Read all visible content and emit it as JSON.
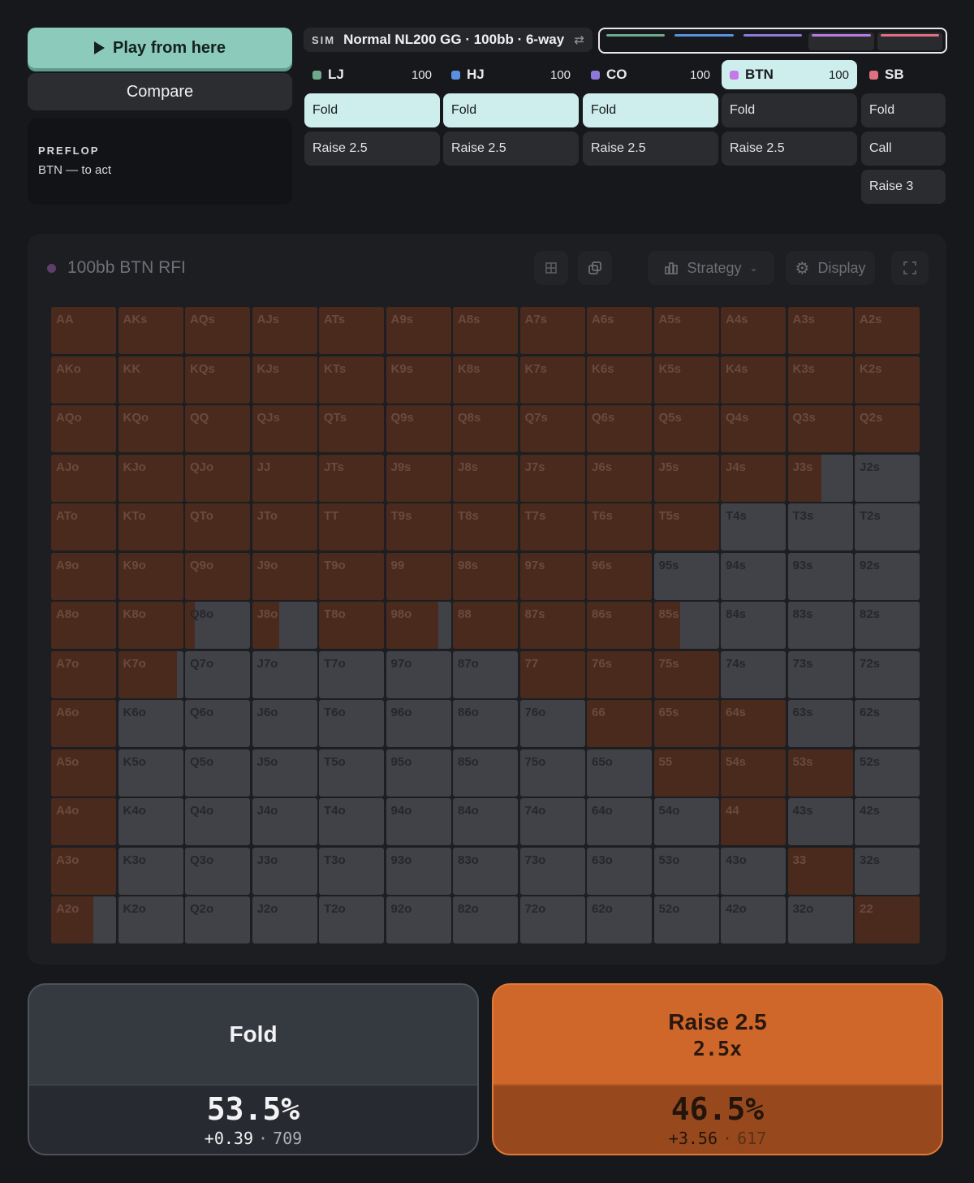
{
  "controls": {
    "play_label": "Play from here",
    "compare_label": "Compare",
    "street": "PREFLOP",
    "to_act": "BTN — to act"
  },
  "sim": {
    "tag": "SIM",
    "title": "Normal NL200 GG · 100bb · 6-way"
  },
  "history_colors": [
    "#6fa98c",
    "#5b8fe0",
    "#8f78d8",
    "#b57be0",
    "#e0707e"
  ],
  "positions": [
    {
      "name": "LJ",
      "stack": "100",
      "color": "#6fa98c",
      "active": false,
      "actions": [
        {
          "label": "Fold",
          "selected": true
        },
        {
          "label": "Raise 2.5",
          "selected": false
        }
      ]
    },
    {
      "name": "HJ",
      "stack": "100",
      "color": "#5b8fe0",
      "active": false,
      "actions": [
        {
          "label": "Fold",
          "selected": true
        },
        {
          "label": "Raise 2.5",
          "selected": false
        }
      ]
    },
    {
      "name": "CO",
      "stack": "100",
      "color": "#8f78d8",
      "active": false,
      "actions": [
        {
          "label": "Fold",
          "selected": true
        },
        {
          "label": "Raise 2.5",
          "selected": false
        }
      ]
    },
    {
      "name": "BTN",
      "stack": "100",
      "color": "#c47ae6",
      "active": true,
      "actions": [
        {
          "label": "Fold",
          "selected": false
        },
        {
          "label": "Raise 2.5",
          "selected": false
        }
      ]
    },
    {
      "name": "SB",
      "stack": "",
      "color": "#e0707e",
      "active": false,
      "actions": [
        {
          "label": "Fold",
          "selected": false
        },
        {
          "label": "Call",
          "selected": false
        },
        {
          "label": "Raise 3",
          "selected": false
        }
      ]
    }
  ],
  "panel": {
    "title": "100bb BTN RFI",
    "strategy_label": "Strategy",
    "display_label": "Display"
  },
  "hands": [
    [
      "AA",
      "AKs",
      "AQs",
      "AJs",
      "ATs",
      "A9s",
      "A8s",
      "A7s",
      "A6s",
      "A5s",
      "A4s",
      "A3s",
      "A2s"
    ],
    [
      "AKo",
      "KK",
      "KQs",
      "KJs",
      "KTs",
      "K9s",
      "K8s",
      "K7s",
      "K6s",
      "K5s",
      "K4s",
      "K3s",
      "K2s"
    ],
    [
      "AQo",
      "KQo",
      "QQ",
      "QJs",
      "QTs",
      "Q9s",
      "Q8s",
      "Q7s",
      "Q6s",
      "Q5s",
      "Q4s",
      "Q3s",
      "Q2s"
    ],
    [
      "AJo",
      "KJo",
      "QJo",
      "JJ",
      "JTs",
      "J9s",
      "J8s",
      "J7s",
      "J6s",
      "J5s",
      "J4s",
      "J3s",
      "J2s"
    ],
    [
      "ATo",
      "KTo",
      "QTo",
      "JTo",
      "TT",
      "T9s",
      "T8s",
      "T7s",
      "T6s",
      "T5s",
      "T4s",
      "T3s",
      "T2s"
    ],
    [
      "A9o",
      "K9o",
      "Q9o",
      "J9o",
      "T9o",
      "99",
      "98s",
      "97s",
      "96s",
      "95s",
      "94s",
      "93s",
      "92s"
    ],
    [
      "A8o",
      "K8o",
      "Q8o",
      "J8o",
      "T8o",
      "98o",
      "88",
      "87s",
      "86s",
      "85s",
      "84s",
      "83s",
      "82s"
    ],
    [
      "A7o",
      "K7o",
      "Q7o",
      "J7o",
      "T7o",
      "97o",
      "87o",
      "77",
      "76s",
      "75s",
      "74s",
      "73s",
      "72s"
    ],
    [
      "A6o",
      "K6o",
      "Q6o",
      "J6o",
      "T6o",
      "96o",
      "86o",
      "76o",
      "66",
      "65s",
      "64s",
      "63s",
      "62s"
    ],
    [
      "A5o",
      "K5o",
      "Q5o",
      "J5o",
      "T5o",
      "95o",
      "85o",
      "75o",
      "65o",
      "55",
      "54s",
      "53s",
      "52s"
    ],
    [
      "A4o",
      "K4o",
      "Q4o",
      "J4o",
      "T4o",
      "94o",
      "84o",
      "74o",
      "64o",
      "54o",
      "44",
      "43s",
      "42s"
    ],
    [
      "A3o",
      "K3o",
      "Q3o",
      "J3o",
      "T3o",
      "93o",
      "83o",
      "73o",
      "63o",
      "53o",
      "43o",
      "33",
      "32s"
    ],
    [
      "A2o",
      "K2o",
      "Q2o",
      "J2o",
      "T2o",
      "92o",
      "82o",
      "72o",
      "62o",
      "52o",
      "42o",
      "32o",
      "22"
    ]
  ],
  "raise_freq": [
    [
      1,
      1,
      1,
      1,
      1,
      1,
      1,
      1,
      1,
      1,
      1,
      1,
      1
    ],
    [
      1,
      1,
      1,
      1,
      1,
      1,
      1,
      1,
      1,
      1,
      1,
      1,
      1
    ],
    [
      1,
      1,
      1,
      1,
      1,
      1,
      1,
      1,
      1,
      1,
      1,
      1,
      1
    ],
    [
      1,
      1,
      1,
      1,
      1,
      1,
      1,
      1,
      1,
      1,
      1,
      0.52,
      0
    ],
    [
      1,
      1,
      1,
      1,
      1,
      1,
      1,
      1,
      1,
      1,
      0,
      0,
      0
    ],
    [
      1,
      1,
      1,
      1,
      1,
      1,
      1,
      1,
      1,
      0,
      0,
      0,
      0
    ],
    [
      1,
      1,
      0.15,
      0.42,
      1,
      0.8,
      1,
      1,
      1,
      0.4,
      0,
      0,
      0
    ],
    [
      1,
      0.9,
      0,
      0,
      0,
      0,
      0,
      1,
      1,
      1,
      0,
      0,
      0
    ],
    [
      1,
      0,
      0,
      0,
      0,
      0,
      0,
      0,
      1,
      1,
      1,
      0,
      0
    ],
    [
      1,
      0,
      0,
      0,
      0,
      0,
      0,
      0,
      0,
      1,
      1,
      1,
      0
    ],
    [
      1,
      0,
      0,
      0,
      0,
      0,
      0,
      0,
      0,
      0,
      1,
      0,
      0
    ],
    [
      1,
      0,
      0,
      0,
      0,
      0,
      0,
      0,
      0,
      0,
      0,
      1,
      0
    ],
    [
      0.65,
      0,
      0,
      0,
      0,
      0,
      0,
      0,
      0,
      0,
      0,
      0,
      1
    ]
  ],
  "summary": {
    "fold": {
      "name": "Fold",
      "pct": "53.5%",
      "ev": "+0.39",
      "count": "709"
    },
    "raise": {
      "name": "Raise 2.5",
      "size": "2.5x",
      "pct": "46.5%",
      "ev": "+3.56",
      "count": "617"
    }
  }
}
